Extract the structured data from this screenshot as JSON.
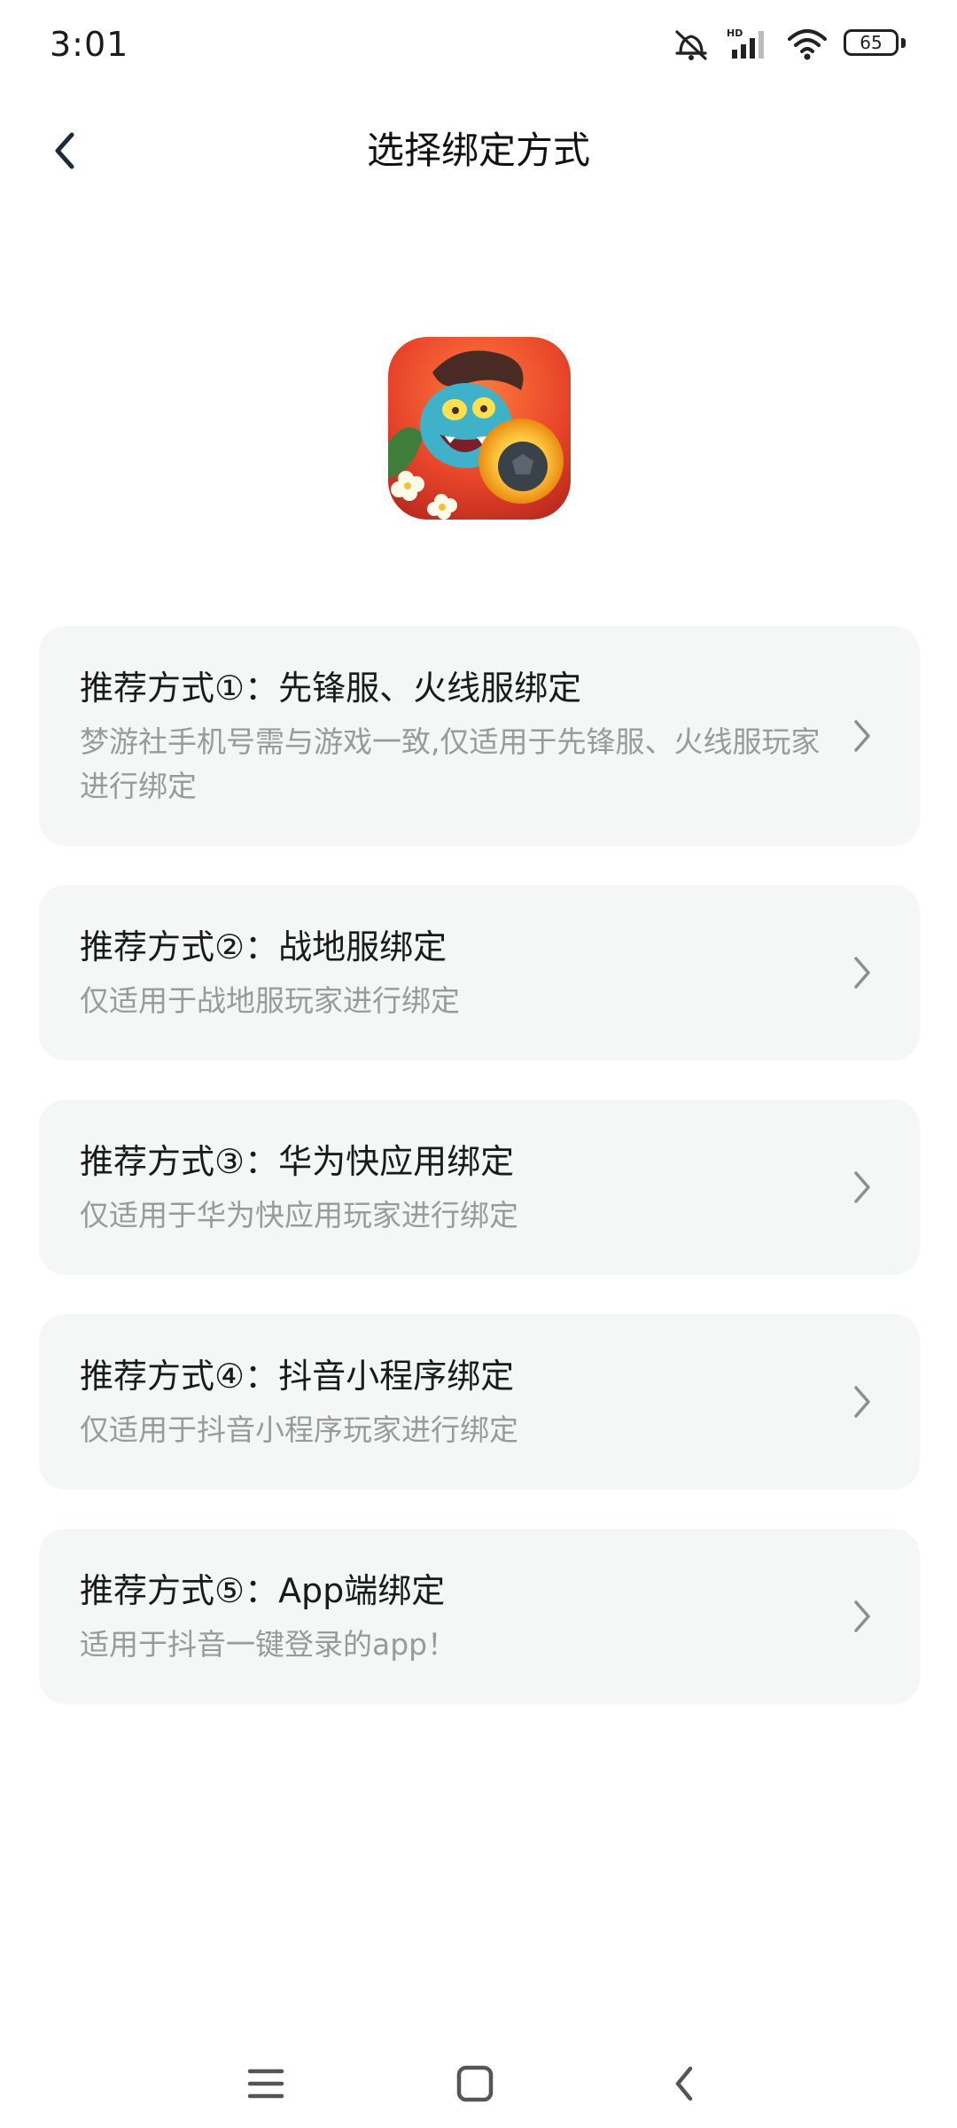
{
  "status_bar": {
    "time": "3:01",
    "battery": "65",
    "icons": [
      "mute-icon",
      "hd-signal-icon",
      "wifi-icon",
      "battery-icon"
    ]
  },
  "header": {
    "title": "选择绑定方式",
    "back_icon": "chevron-left-icon"
  },
  "app_icon": {
    "description": "game-app-icon"
  },
  "options": [
    {
      "title": "推荐方式①：先锋服、火线服绑定",
      "desc": "梦游社手机号需与游戏一致,仅适用于先锋服、火线服玩家进行绑定"
    },
    {
      "title": "推荐方式②：战地服绑定",
      "desc": "仅适用于战地服玩家进行绑定"
    },
    {
      "title": "推荐方式③：华为快应用绑定",
      "desc": "仅适用于华为快应用玩家进行绑定"
    },
    {
      "title": "推荐方式④：抖音小程序绑定",
      "desc": "仅适用于抖音小程序玩家进行绑定"
    },
    {
      "title": "推荐方式⑤：App端绑定",
      "desc": "适用于抖音一键登录的app！"
    }
  ],
  "nav_bar": {
    "icons": [
      "menu-icon",
      "home-square-icon",
      "back-arrow-icon"
    ]
  },
  "colors": {
    "card_background": "#f5f6f6",
    "title_text": "#1a1a1a",
    "desc_text": "#9a9a9a",
    "background": "#ffffff"
  }
}
